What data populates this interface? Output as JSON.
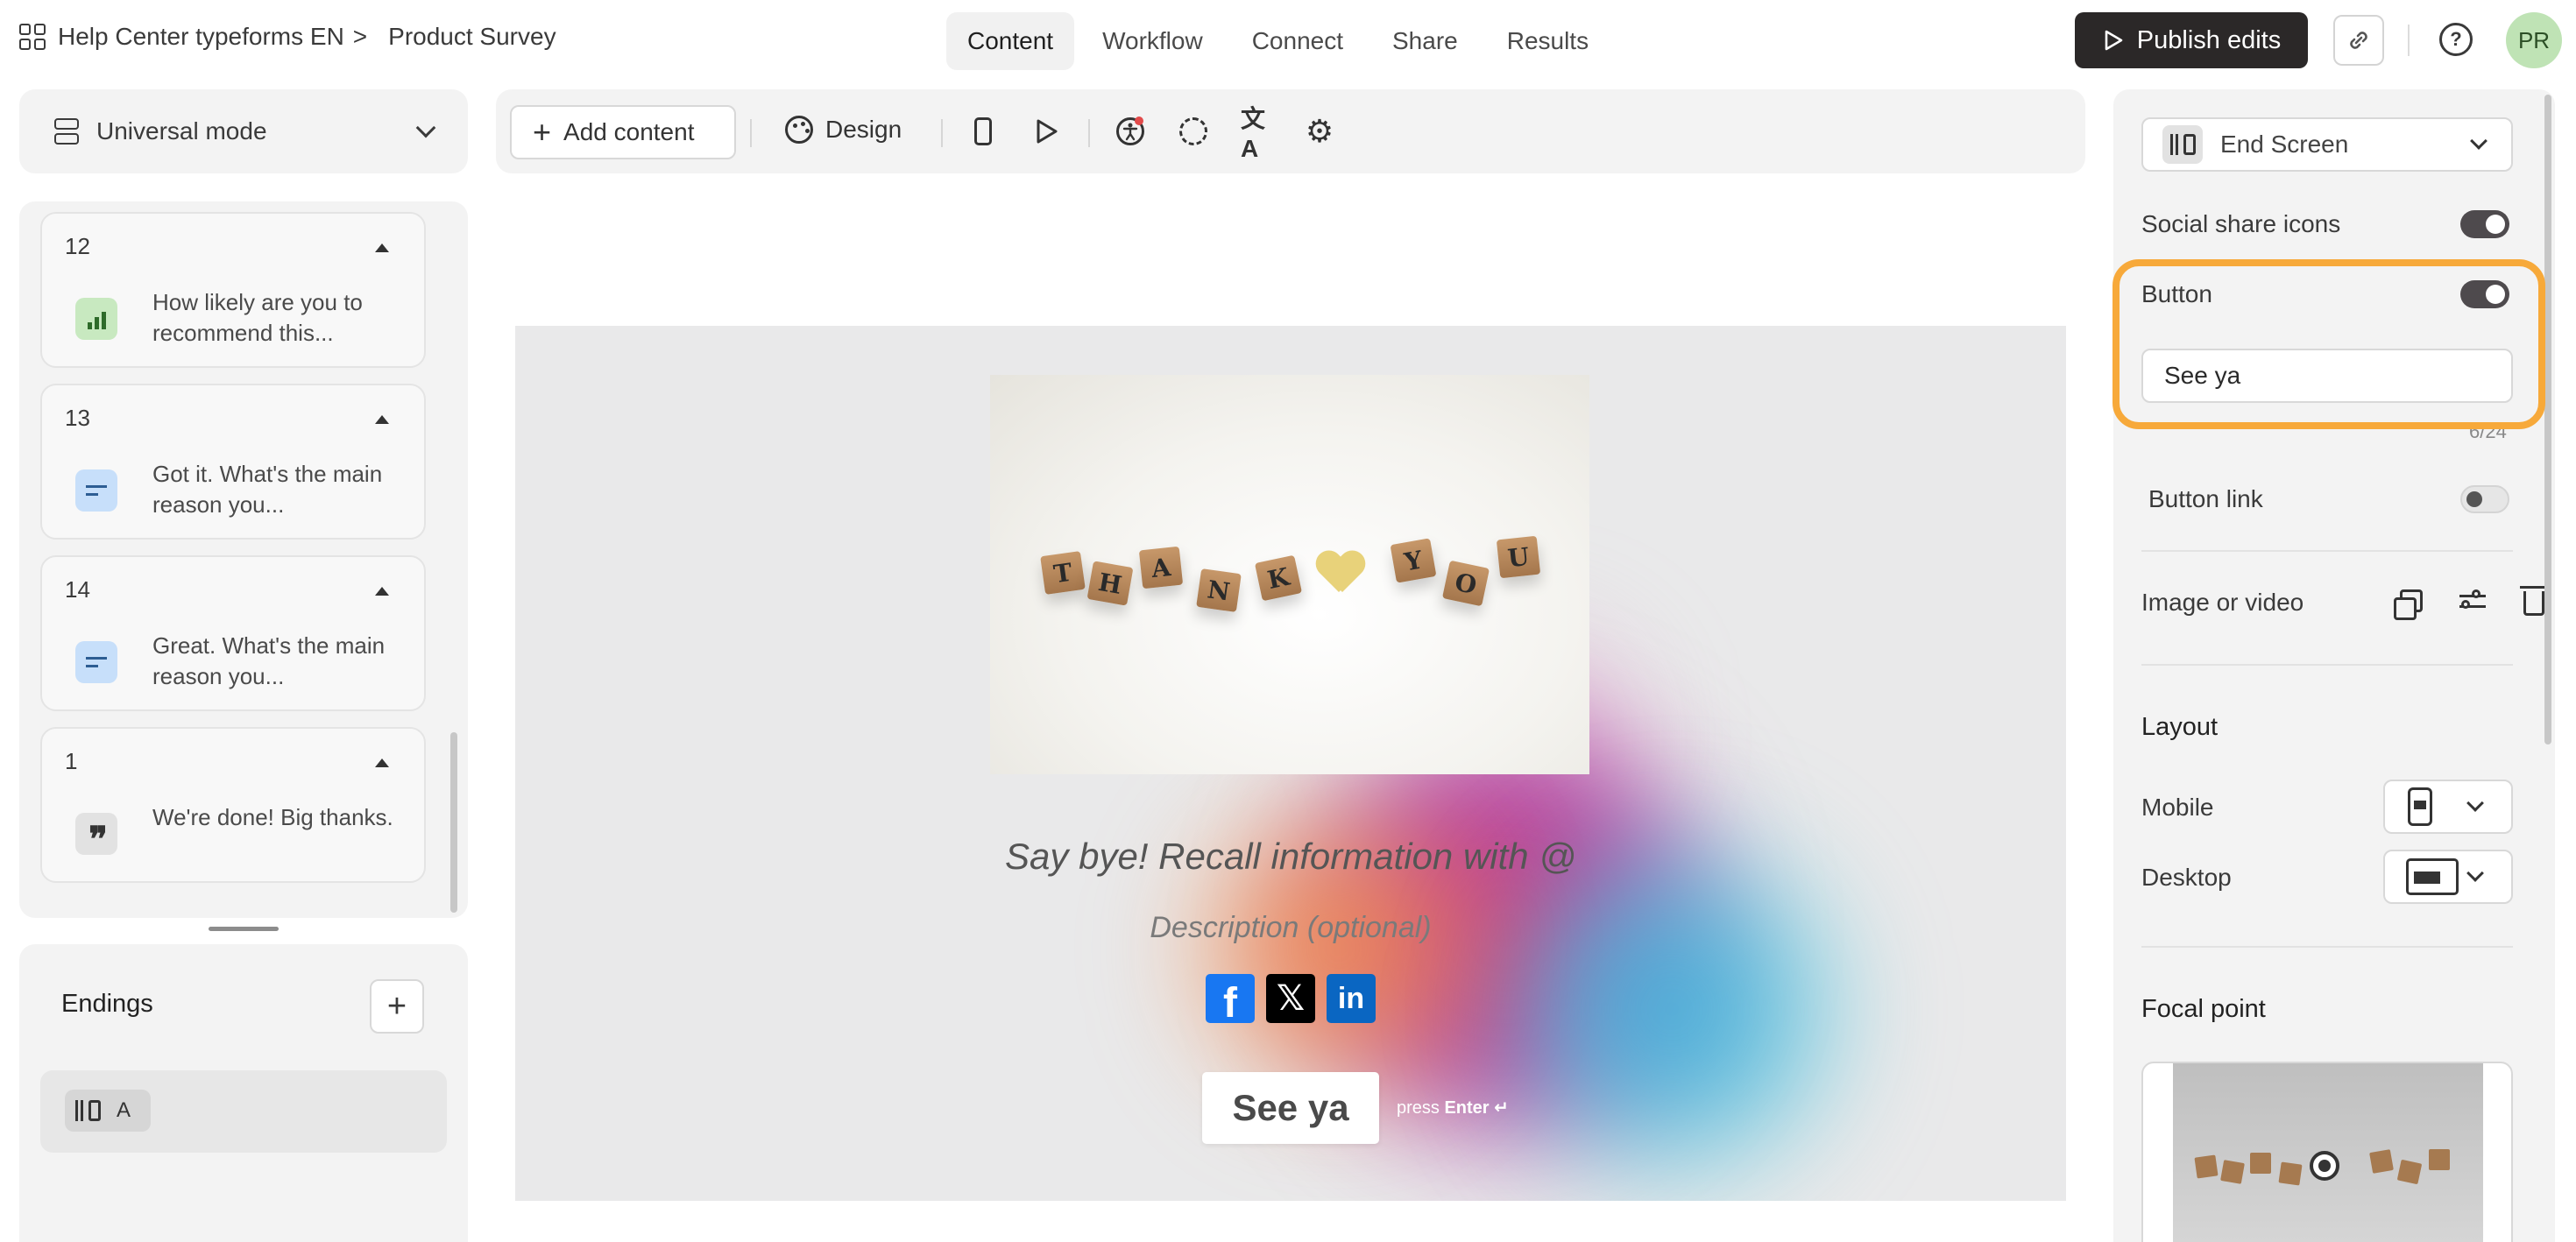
{
  "header": {
    "breadcrumb_workspace": "Help Center typeforms EN",
    "breadcrumb_separator": ">",
    "form_name": "Product Survey",
    "tabs": [
      {
        "label": "Content",
        "active": true
      },
      {
        "label": "Workflow",
        "active": false
      },
      {
        "label": "Connect",
        "active": false
      },
      {
        "label": "Share",
        "active": false
      },
      {
        "label": "Results",
        "active": false
      }
    ],
    "publish_label": "Publish edits",
    "avatar_initials": "PR"
  },
  "sidebar": {
    "mode_label": "Universal mode",
    "questions": [
      {
        "number": "12",
        "text": "How likely are you to recommend this...",
        "icon": "opinion-scale-icon"
      },
      {
        "number": "13",
        "text": "Got it. What's the main reason you...",
        "icon": "long-text-icon"
      },
      {
        "number": "14",
        "text": "Great. What's the main reason you...",
        "icon": "long-text-icon"
      },
      {
        "number": "1",
        "text": "We're done! Big thanks.",
        "icon": "statement-quote-icon"
      }
    ],
    "endings_title": "Endings",
    "endings_add": "+",
    "endings": [
      {
        "label": "A"
      }
    ]
  },
  "toolbar": {
    "add_content_label": "Add content",
    "design_label": "Design"
  },
  "canvas": {
    "photo_letters": [
      "T",
      "H",
      "A",
      "N",
      "K",
      "Y",
      "O",
      "U"
    ],
    "title": "Say bye! Recall information with @",
    "description_placeholder": "Description (optional)",
    "socials": [
      {
        "name": "facebook",
        "glyph": "f"
      },
      {
        "name": "x",
        "glyph": "𝕏"
      },
      {
        "name": "linkedin",
        "glyph": "in"
      }
    ],
    "button_label": "See ya",
    "press_label": "press",
    "enter_label": "Enter ↵"
  },
  "settings": {
    "screen_type": "End Screen",
    "social_share_label": "Social share icons",
    "social_share_on": true,
    "button_label": "Button",
    "button_on": true,
    "button_text_value": "See ya",
    "button_char_count": "6/24",
    "button_link_label": "Button link",
    "button_link_on": false,
    "image_video_label": "Image or video",
    "layout_heading": "Layout",
    "mobile_label": "Mobile",
    "desktop_label": "Desktop",
    "focal_point_heading": "Focal point"
  },
  "colors": {
    "accent_highlight": "#f7a93a",
    "publish_bg": "#2b2828",
    "avatar_bg": "#bfe3b5",
    "facebook": "#1877f2",
    "linkedin": "#0a66c2"
  }
}
